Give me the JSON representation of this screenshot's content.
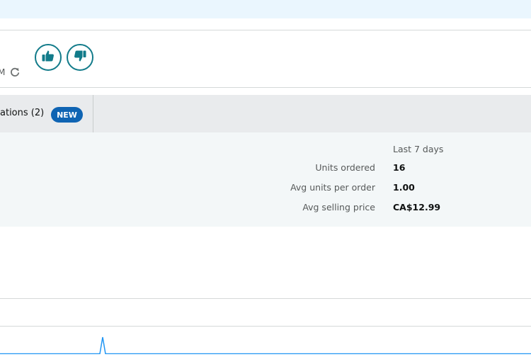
{
  "header": {
    "timestamp_fragment": "M",
    "refresh_icon": "refresh-icon"
  },
  "feedback": {
    "thumbs_up_icon": "thumbs-up-icon",
    "thumbs_down_icon": "thumbs-down-icon",
    "accent_color": "#127b8a"
  },
  "tabs": [
    {
      "label": "ations (2)",
      "badge": "NEW",
      "badge_color": "#0f64b3"
    }
  ],
  "stats": {
    "period_label": "Last 7 days",
    "rows": [
      {
        "label": "Units ordered",
        "value": "16"
      },
      {
        "label": "Avg units per order",
        "value": "1.00"
      },
      {
        "label": "Avg selling price",
        "value": "CA$12.99"
      }
    ]
  },
  "chart": {
    "line_color": "#2196f3"
  }
}
